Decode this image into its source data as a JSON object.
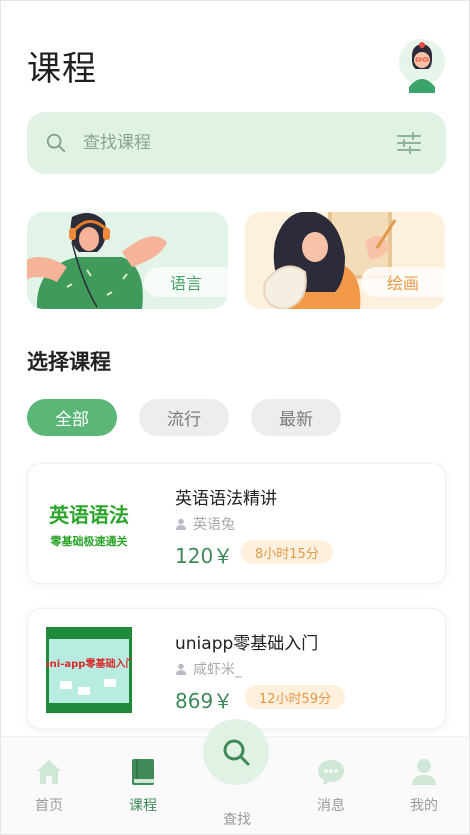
{
  "header": {
    "title": "课程"
  },
  "search": {
    "placeholder": "查找课程"
  },
  "banners": [
    {
      "label": "语言"
    },
    {
      "label": "绘画"
    }
  ],
  "section": {
    "title": "选择课程"
  },
  "filters": [
    "全部",
    "流行",
    "最新"
  ],
  "courses": [
    {
      "title": "英语语法精讲",
      "author": "英语兔",
      "price": "120￥",
      "duration": "8小时15分",
      "thumb_line1": "英语语法",
      "thumb_line2": "零基础极速通关"
    },
    {
      "title": "uniapp零基础入门",
      "author": "咸虾米_",
      "price": "869￥",
      "duration": "12小时59分",
      "thumb_text": "uni-app零基础入门"
    }
  ],
  "tabbar": {
    "items": [
      "首页",
      "课程",
      "查找",
      "消息",
      "我的"
    ],
    "active": "课程"
  },
  "colors": {
    "accent": "#5cb677",
    "accent_dark": "#3f8a58",
    "mint": "#dff2e4",
    "peach": "#fdf0dc",
    "orange": "#e29a4a"
  }
}
